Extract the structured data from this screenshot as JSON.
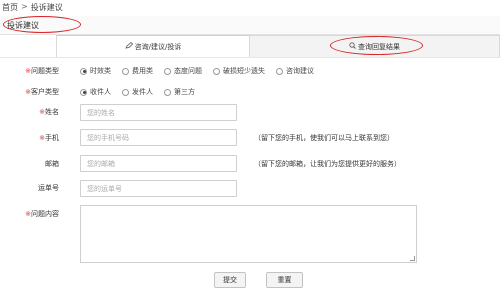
{
  "breadcrumb": {
    "home": "首页",
    "separator": ">",
    "current": "投诉建议"
  },
  "section": {
    "title": "投诉建议"
  },
  "tabs": [
    {
      "label": "咨询/建议/投诉",
      "icon": "pencil-icon",
      "active": true
    },
    {
      "label": "查询回复结果",
      "icon": "search-icon",
      "active": false
    }
  ],
  "form": {
    "problem_type": {
      "label": "问题类型",
      "required_mark": "※",
      "options": [
        "时效类",
        "费用类",
        "态度问题",
        "破损短少遗失",
        "咨询建议"
      ],
      "selected": "时效类"
    },
    "customer_type": {
      "label": "客户类型",
      "required_mark": "※",
      "options": [
        "收件人",
        "发件人",
        "第三方"
      ],
      "selected": "收件人"
    },
    "name": {
      "label": "姓名",
      "required_mark": "※",
      "placeholder": "您的姓名"
    },
    "phone": {
      "label": "手机",
      "required_mark": "※",
      "placeholder": "您的手机号码",
      "hint": "（留下您的手机，使我们可以马上联系到您）"
    },
    "email": {
      "label": "邮箱",
      "placeholder": "您的邮箱",
      "hint": "（留下您的邮箱，让我们为您提供更好的服务）"
    },
    "tracking": {
      "label": "运单号",
      "placeholder": "您的运单号"
    },
    "content": {
      "label": "问题内容",
      "required_mark": "※"
    }
  },
  "buttons": {
    "submit": "提交",
    "reset": "重置"
  },
  "colors": {
    "annotation": "#d5252a",
    "required": "#e53935"
  }
}
